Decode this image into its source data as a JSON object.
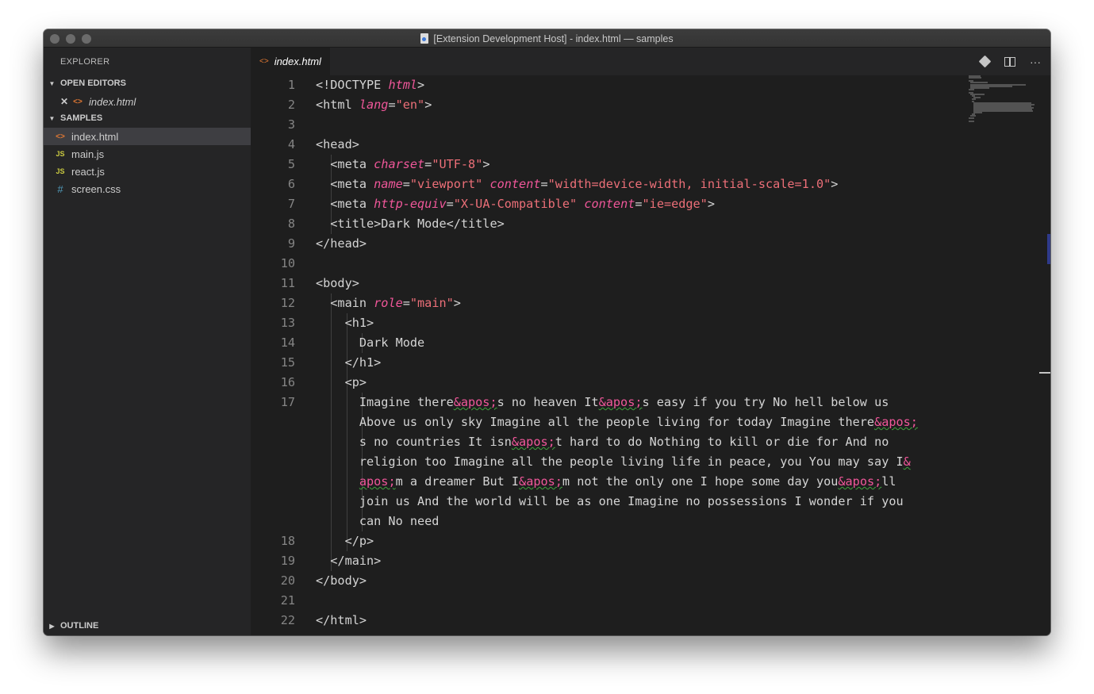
{
  "window": {
    "title": "[Extension Development Host] - index.html — samples"
  },
  "sidebar": {
    "title": "EXPLORER",
    "open_editors": {
      "label": "OPEN EDITORS",
      "items": [
        {
          "name": "index.html",
          "close_icon": "✕"
        }
      ]
    },
    "samples": {
      "label": "SAMPLES",
      "files": [
        {
          "name": "index.html",
          "icon": "html-icon",
          "glyph": "<>"
        },
        {
          "name": "main.js",
          "icon": "js-icon",
          "glyph": "JS"
        },
        {
          "name": "react.js",
          "icon": "js-icon",
          "glyph": "JS"
        },
        {
          "name": "screen.css",
          "icon": "css-icon",
          "glyph": "#"
        }
      ]
    },
    "outline": {
      "label": "OUTLINE"
    }
  },
  "editor": {
    "tab": {
      "label": "index.html",
      "glyph": "<>"
    },
    "line_numbers": [
      "1",
      "2",
      "3",
      "4",
      "5",
      "6",
      "7",
      "8",
      "9",
      "10",
      "11",
      "12",
      "13",
      "14",
      "15",
      "16",
      "17",
      "18",
      "19",
      "20",
      "21",
      "22"
    ],
    "lines": [
      [
        [
          "t",
          "<!DOCTYPE "
        ],
        [
          "a",
          "html"
        ],
        [
          "t",
          ">"
        ]
      ],
      [
        [
          "t",
          "<html "
        ],
        [
          "a",
          "lang"
        ],
        [
          "t",
          "="
        ],
        [
          "s",
          "\"en\""
        ],
        [
          "t",
          ">"
        ]
      ],
      [],
      [
        [
          "t",
          "<head>"
        ]
      ],
      [
        [
          "t",
          "  <meta "
        ],
        [
          "a",
          "charset"
        ],
        [
          "t",
          "="
        ],
        [
          "s",
          "\"UTF-8\""
        ],
        [
          "t",
          ">"
        ]
      ],
      [
        [
          "t",
          "  <meta "
        ],
        [
          "a",
          "name"
        ],
        [
          "t",
          "="
        ],
        [
          "s",
          "\"viewport\""
        ],
        [
          "t",
          " "
        ],
        [
          "a",
          "content"
        ],
        [
          "t",
          "="
        ],
        [
          "s",
          "\"width=device-width, initial-scale=1.0\""
        ],
        [
          "t",
          ">"
        ]
      ],
      [
        [
          "t",
          "  <meta "
        ],
        [
          "a",
          "http-equiv"
        ],
        [
          "t",
          "="
        ],
        [
          "s",
          "\"X-UA-Compatible\""
        ],
        [
          "t",
          " "
        ],
        [
          "a",
          "content"
        ],
        [
          "t",
          "="
        ],
        [
          "s",
          "\"ie=edge\""
        ],
        [
          "t",
          ">"
        ]
      ],
      [
        [
          "t",
          "  <title>Dark Mode</title>"
        ]
      ],
      [
        [
          "t",
          "</head>"
        ]
      ],
      [],
      [
        [
          "t",
          "<body>"
        ]
      ],
      [
        [
          "t",
          "  <main "
        ],
        [
          "a",
          "role"
        ],
        [
          "t",
          "="
        ],
        [
          "s",
          "\"main\""
        ],
        [
          "t",
          ">"
        ]
      ],
      [
        [
          "t",
          "    <h1>"
        ]
      ],
      [
        [
          "t",
          "      Dark Mode"
        ]
      ],
      [
        [
          "t",
          "    </h1>"
        ]
      ],
      [
        [
          "t",
          "    <p>"
        ]
      ],
      [
        [
          "t",
          "      Imagine there"
        ],
        [
          "e",
          "&apos;"
        ],
        [
          "t",
          "s no heaven It"
        ],
        [
          "e",
          "&apos;"
        ],
        [
          "t",
          "s easy if you try No hell below us"
        ]
      ],
      [
        [
          "t",
          "      Above us only sky Imagine all the people living for today Imagine there"
        ],
        [
          "e",
          "&apos;"
        ]
      ],
      [
        [
          "t",
          "      s no countries It isn"
        ],
        [
          "e",
          "&apos;"
        ],
        [
          "t",
          "t hard to do Nothing to kill or die for And no"
        ]
      ],
      [
        [
          "t",
          "      religion too Imagine all the people living life in peace, you You may say I"
        ],
        [
          "e",
          "&"
        ]
      ],
      [
        [
          "t",
          "      "
        ],
        [
          "e",
          "apos;"
        ],
        [
          "t",
          "m a dreamer But I"
        ],
        [
          "e",
          "&apos;"
        ],
        [
          "t",
          "m not the only one I hope some day you"
        ],
        [
          "e",
          "&apos;"
        ],
        [
          "t",
          "ll"
        ]
      ],
      [
        [
          "t",
          "      join us And the world will be as one Imagine no possessions I wonder if you"
        ]
      ],
      [
        [
          "t",
          "      can No need"
        ]
      ],
      [
        [
          "t",
          "    </p>"
        ]
      ],
      [
        [
          "t",
          "  </main>"
        ]
      ],
      [
        [
          "t",
          "</body>"
        ]
      ],
      [],
      [
        [
          "t",
          "</html>"
        ]
      ]
    ]
  },
  "colors": {
    "accent": "#f0579a",
    "string": "#ec6f78",
    "background": "#1e1e1e",
    "sidebar": "#252526"
  },
  "icons": [
    "close-icon",
    "git-compare-icon",
    "split-editor-icon",
    "more-actions-icon",
    "chevron-down-icon",
    "chevron-right-icon"
  ]
}
